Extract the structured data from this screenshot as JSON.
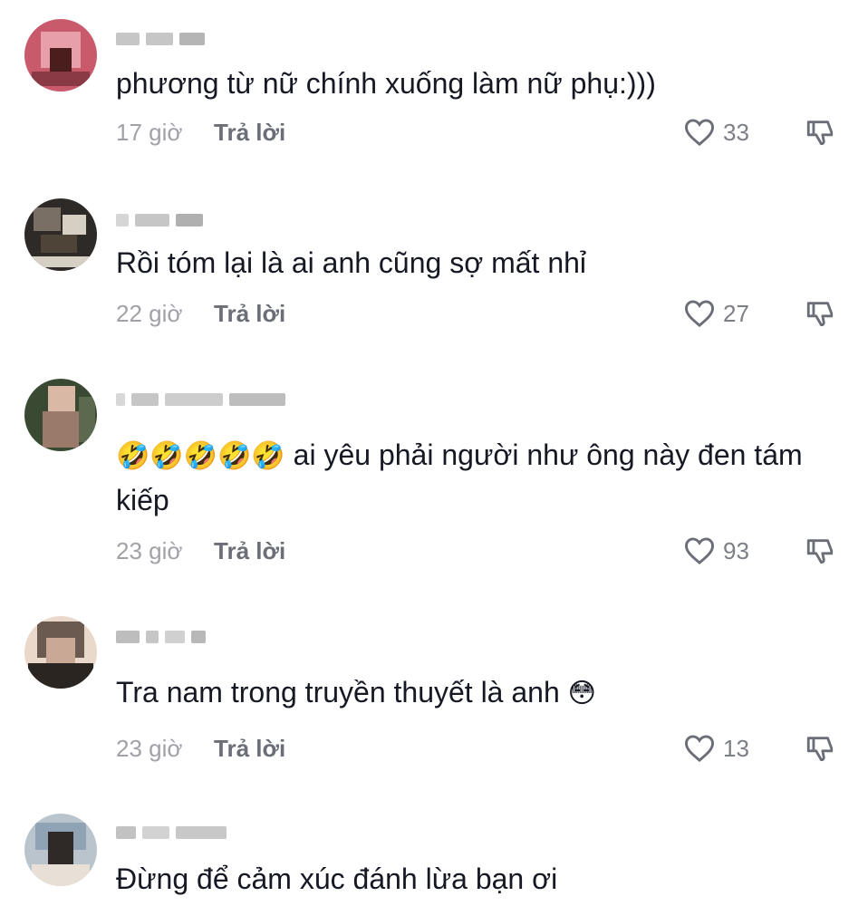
{
  "comments": [
    {
      "text": "phương từ nữ chính xuống làm nữ phụ:)))",
      "emoji": "",
      "time": "17 giờ",
      "reply": "Trả lời",
      "likes": "33",
      "avatar_colors": [
        "#c85a6b",
        "#e7a0a9",
        "#4b1e1e",
        "#8a3a45"
      ]
    },
    {
      "text": "Rồi tóm lại là ai anh cũng sợ mất nhỉ",
      "emoji": "",
      "time": "22 giờ",
      "reply": "Trả lời",
      "likes": "27",
      "avatar_colors": [
        "#2d2a28",
        "#7a6f64",
        "#d6cfc4",
        "#4e4538"
      ]
    },
    {
      "emoji": "🤣🤣🤣🤣🤣",
      "text": "ai yêu phải người như ông này đen tám kiếp",
      "time": "23 giờ",
      "reply": "Trả lời",
      "likes": "93",
      "avatar_colors": [
        "#3a4a32",
        "#9a7a6a",
        "#d9b8a6",
        "#5b6a4e"
      ]
    },
    {
      "text": "Tra nam trong truyền thuyết là anh",
      "emoji": "😳",
      "time": "23 giờ",
      "reply": "Trả lời",
      "likes": "13",
      "avatar_colors": [
        "#2b2522",
        "#c9a996",
        "#ead8ca",
        "#6a5a50"
      ]
    },
    {
      "text": "Đừng để cảm xúc đánh lừa bạn ơi",
      "emoji": "",
      "time": "",
      "reply": "",
      "likes": "",
      "avatar_colors": [
        "#8fa3b5",
        "#e8dfd6",
        "#2f2a27",
        "#b9c4cc"
      ]
    }
  ]
}
